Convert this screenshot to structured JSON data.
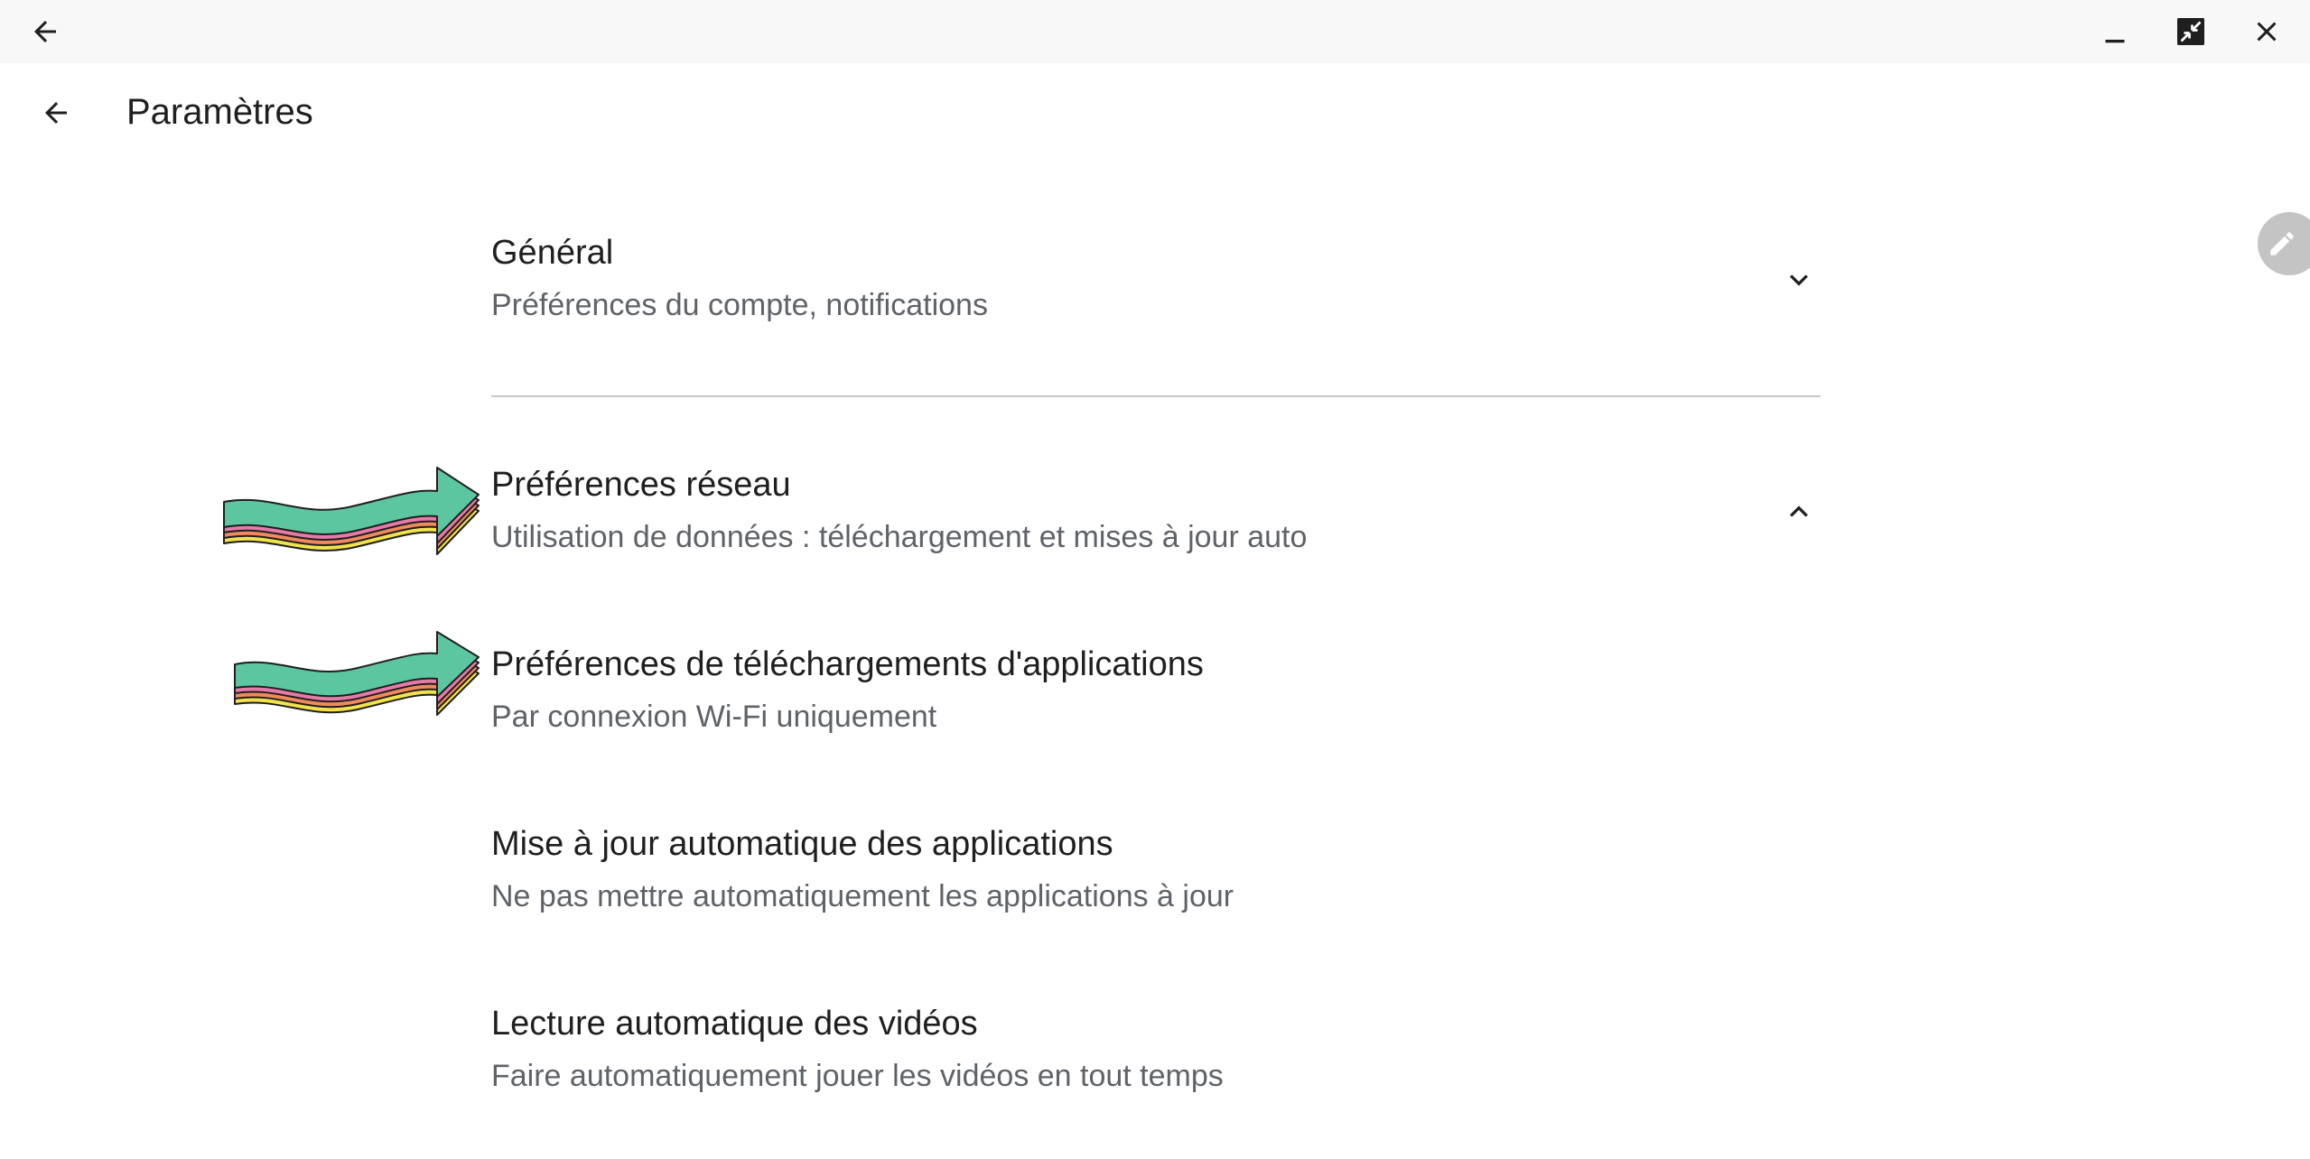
{
  "window": {
    "back_icon": "arrow-left-icon",
    "minimize_icon": "minimize-icon",
    "restore_icon": "restore-icon",
    "close_icon": "close-icon"
  },
  "header": {
    "title": "Paramètres",
    "back_icon": "arrow-left-icon"
  },
  "sections": [
    {
      "title": "Général",
      "subtitle": "Préférences du compte, notifications",
      "expanded": false,
      "chevron_icon": "chevron-down-icon"
    },
    {
      "title": "Préférences réseau",
      "subtitle": "Utilisation de données : téléchargement et mises à jour auto",
      "expanded": true,
      "chevron_icon": "chevron-up-icon"
    }
  ],
  "network_items": [
    {
      "title": "Préférences de téléchargements d'applications",
      "subtitle": "Par connexion Wi-Fi uniquement"
    },
    {
      "title": "Mise à jour automatique des applications",
      "subtitle": "Ne pas mettre automatiquement les applications à jour"
    },
    {
      "title": "Lecture automatique des vidéos",
      "subtitle": "Faire automatiquement jouer les vidéos en tout temps"
    }
  ],
  "floating": {
    "edit_icon": "pencil-icon"
  },
  "annotations": {
    "arrow_colors": [
      "#5cc6a0",
      "#e67aa8",
      "#f08a5d",
      "#f2e34c"
    ]
  }
}
